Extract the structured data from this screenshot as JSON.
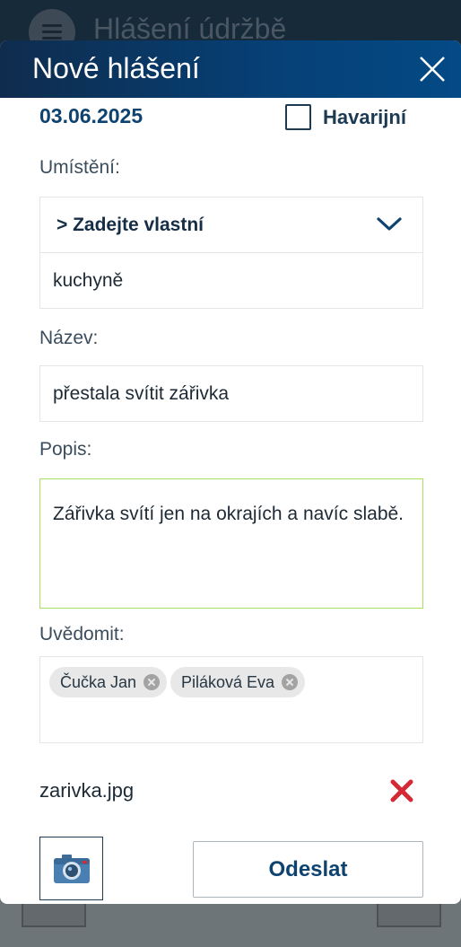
{
  "background": {
    "title": "Hlášení údržbě"
  },
  "modal": {
    "title": "Nové hlášení",
    "date": "03.06.2025",
    "emergency_label": "Havarijní",
    "emergency_checked": false,
    "location": {
      "label": "Umístění:",
      "selected_option": "> Zadejte vlastní",
      "custom_value": "kuchyně"
    },
    "name": {
      "label": "Název:",
      "value": "přestala svítit zářivka"
    },
    "description": {
      "label": "Popis:",
      "value": "Zářivka svítí jen na okrajích a navíc slabě."
    },
    "notify": {
      "label": "Uvědomit:",
      "recipients": [
        "Čučka Jan",
        "Piláková Eva"
      ]
    },
    "attachment": {
      "file_name": "zarivka.jpg"
    },
    "send_label": "Odeslat"
  },
  "colors": {
    "header": "#063f74",
    "accent_text": "#0e426f",
    "focus_border": "#a8e064",
    "delete_red": "#d42a35"
  },
  "icons": {
    "close": "close-icon",
    "chevron": "chevron-down-icon",
    "delete": "delete-icon",
    "camera": "camera-icon",
    "menu": "menu-icon"
  }
}
